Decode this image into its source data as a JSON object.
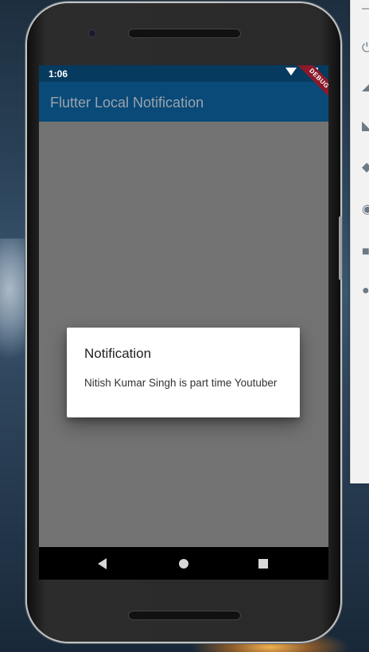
{
  "status_bar": {
    "time": "1:06"
  },
  "app_bar": {
    "title": "Flutter Local Notification",
    "debug_banner": "DEBUG"
  },
  "dialog": {
    "title": "Notification",
    "body": "Nitish Kumar Singh is part time Youtuber"
  },
  "navigation": {
    "back": "back-icon",
    "home": "home-icon",
    "recents": "recents-icon"
  },
  "colors": {
    "app_bar": "#0a4a78",
    "status_bar": "#063a5e",
    "scrim": "#737373",
    "debug_banner": "#8b1a2a"
  }
}
